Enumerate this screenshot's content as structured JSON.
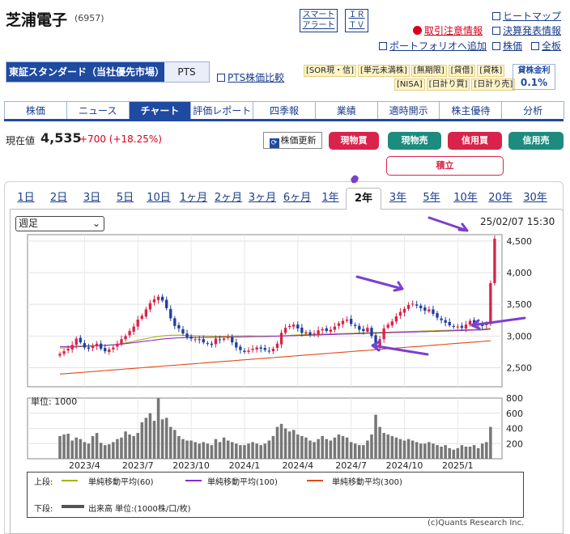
{
  "header": {
    "company": "芝浦電子",
    "code": "(6957)",
    "smart_alert": [
      "スマート",
      "アラート"
    ],
    "ir_tv": [
      "ＩＲ",
      "ＴＶ"
    ],
    "links": {
      "heatmap": "ヒートマップ",
      "restriction": "取引注意情報",
      "earnings": "決算発表情報",
      "portfolio": "ポートフォリオへ追加",
      "stock_price": "株価",
      "all_boards": "全板"
    }
  },
  "market": {
    "main": "東証スタンダード（当社優先市場）",
    "pts": "PTS",
    "pts_compare": "PTS株価比較",
    "tags_row1": [
      "[SOR現・信]",
      "[単元未満株]",
      "[無期限]",
      "[貸借]",
      "[貸株]"
    ],
    "tags_row2": [
      "[NISA]",
      "[日計り買]",
      "[日計り売]"
    ],
    "kashi_label": "貸株金利",
    "kashi_rate": "0.1%"
  },
  "tabs": [
    "株価",
    "ニュース",
    "チャート",
    "評価レポート",
    "四季報",
    "業績",
    "適時開示",
    "株主優待",
    "分析"
  ],
  "active_tab": "チャート",
  "price": {
    "label": "現在値",
    "value": "4,535",
    "change": "+700 (+18.25%)",
    "refresh": "株価更新",
    "buttons": {
      "spot_buy": "現物買",
      "spot_sell": "現物売",
      "margin_buy": "信用買",
      "margin_sell": "信用売",
      "accumulate": "積立"
    }
  },
  "periods": [
    "1日",
    "2日",
    "3日",
    "5日",
    "10日",
    "1ヶ月",
    "2ヶ月",
    "3ヶ月",
    "6ヶ月",
    "1年",
    "2年",
    "3年",
    "5年",
    "10年",
    "20年",
    "30年"
  ],
  "active_period": "2年",
  "chart_controls": {
    "interval": "週足",
    "datetime": "25/02/07 15:30",
    "volume_unit": "単位: 1000"
  },
  "chart_data": {
    "type": "candlestick",
    "x_labels": [
      "2023/4",
      "2023/7",
      "2023/10",
      "2024/1",
      "2024/4",
      "2024/7",
      "2024/10",
      "2025/1"
    ],
    "ylim": [
      2200,
      4600
    ],
    "y_ticks": [
      2500,
      3000,
      3500,
      4000,
      4500
    ],
    "volume_ylim": [
      0,
      800
    ],
    "volume_ticks": [
      200,
      400,
      600,
      800
    ],
    "closes": [
      2720,
      2760,
      2800,
      2860,
      2960,
      2900,
      2820,
      2800,
      2850,
      2880,
      2800,
      2760,
      2790,
      2820,
      2880,
      2950,
      3000,
      3080,
      3150,
      3260,
      3320,
      3420,
      3520,
      3580,
      3620,
      3560,
      3440,
      3280,
      3160,
      3120,
      3040,
      2980,
      2960,
      2950,
      2940,
      2900,
      2880,
      2860,
      2960,
      2940,
      2960,
      2990,
      2900,
      2820,
      2780,
      2750,
      2770,
      2800,
      2820,
      2800,
      2780,
      2760,
      2800,
      2880,
      3050,
      3130,
      3160,
      3180,
      3120,
      3050,
      3060,
      3020,
      3040,
      3090,
      3110,
      3080,
      3100,
      3150,
      3200,
      3240,
      3260,
      3190,
      3160,
      3100,
      3080,
      3130,
      3000,
      2830,
      2950,
      3120,
      3180,
      3230,
      3310,
      3380,
      3430,
      3490,
      3510,
      3480,
      3440,
      3400,
      3420,
      3350,
      3290,
      3250,
      3210,
      3170,
      3150,
      3150,
      3130,
      3180,
      3240,
      3200,
      3180,
      3160,
      3200,
      3835,
      4535
    ],
    "ma60": [
      2810,
      2815,
      2818,
      2822,
      2828,
      2832,
      2836,
      2838,
      2842,
      2846,
      2848,
      2852,
      2856,
      2862,
      2870,
      2880,
      2892,
      2904,
      2918,
      2932,
      2946,
      2960,
      2972,
      2984,
      2994,
      3002,
      3008,
      3012,
      3014,
      3014,
      3012,
      3010,
      3008,
      3006,
      3004,
      3002,
      3000,
      2999,
      2998,
      2998,
      2999,
      3000,
      3002,
      3003,
      3004,
      3004,
      3003,
      3002,
      3001,
      3000,
      3000,
      3000,
      3000,
      3001,
      3003,
      3006,
      3010,
      3014,
      3018,
      3020,
      3022,
      3024,
      3026,
      3028,
      3030,
      3032,
      3034,
      3036,
      3038,
      3040,
      3042,
      3044,
      3046,
      3048,
      3050,
      3052,
      3054,
      3056,
      3058,
      3060,
      3062,
      3064,
      3066,
      3068,
      3070,
      3072,
      3074,
      3076,
      3078,
      3080,
      3082,
      3084,
      3086,
      3088,
      3090,
      3092,
      3094,
      3096,
      3098,
      3100,
      3102,
      3104,
      3106,
      3108,
      3115,
      3125
    ],
    "ma100": [
      2830,
      2832,
      2834,
      2836,
      2838,
      2840,
      2842,
      2844,
      2846,
      2848,
      2850,
      2852,
      2856,
      2860,
      2866,
      2872,
      2880,
      2888,
      2896,
      2904,
      2912,
      2920,
      2928,
      2936,
      2944,
      2952,
      2958,
      2964,
      2968,
      2972,
      2974,
      2976,
      2977,
      2978,
      2979,
      2980,
      2980,
      2980,
      2981,
      2982,
      2983,
      2984,
      2985,
      2986,
      2987,
      2988,
      2989,
      2990,
      2991,
      2992,
      2993,
      2994,
      2996,
      2998,
      3000,
      3002,
      3004,
      3006,
      3008,
      3010,
      3012,
      3014,
      3016,
      3018,
      3020,
      3022,
      3024,
      3026,
      3028,
      3030,
      3032,
      3034,
      3036,
      3038,
      3040,
      3042,
      3044,
      3046,
      3048,
      3050,
      3052,
      3054,
      3056,
      3058,
      3060,
      3062,
      3064,
      3066,
      3068,
      3070,
      3072,
      3074,
      3076,
      3078,
      3080,
      3082,
      3084,
      3086,
      3088,
      3090,
      3092,
      3094,
      3096,
      3098,
      3102,
      3110
    ],
    "ma300": [
      2400,
      2405,
      2410,
      2415,
      2420,
      2425,
      2430,
      2435,
      2440,
      2445,
      2450,
      2455,
      2460,
      2465,
      2470,
      2475,
      2480,
      2485,
      2490,
      2495,
      2500,
      2505,
      2510,
      2515,
      2520,
      2525,
      2530,
      2535,
      2540,
      2545,
      2550,
      2555,
      2560,
      2565,
      2570,
      2575,
      2580,
      2585,
      2590,
      2595,
      2600,
      2605,
      2610,
      2615,
      2620,
      2625,
      2630,
      2635,
      2640,
      2645,
      2650,
      2655,
      2660,
      2665,
      2670,
      2675,
      2680,
      2685,
      2690,
      2695,
      2700,
      2705,
      2710,
      2715,
      2720,
      2725,
      2730,
      2735,
      2740,
      2745,
      2750,
      2755,
      2760,
      2765,
      2770,
      2775,
      2780,
      2785,
      2790,
      2795,
      2800,
      2805,
      2810,
      2815,
      2820,
      2825,
      2830,
      2835,
      2840,
      2845,
      2850,
      2855,
      2860,
      2865,
      2870,
      2875,
      2880,
      2885,
      2890,
      2895,
      2900,
      2905,
      2910,
      2915,
      2920,
      2925
    ],
    "volume": [
      300,
      320,
      330,
      240,
      280,
      260,
      220,
      200,
      300,
      340,
      210,
      180,
      190,
      220,
      260,
      280,
      360,
      320,
      300,
      340,
      480,
      540,
      600,
      500,
      800,
      520,
      540,
      420,
      380,
      300,
      260,
      240,
      240,
      220,
      200,
      220,
      200,
      180,
      260,
      220,
      280,
      240,
      220,
      200,
      180,
      180,
      200,
      220,
      200,
      180,
      200,
      240,
      300,
      420,
      460,
      400,
      360,
      380,
      320,
      300,
      280,
      240,
      220,
      260,
      300,
      260,
      240,
      280,
      320,
      300,
      280,
      220,
      200,
      180,
      180,
      240,
      320,
      580,
      420,
      340,
      320,
      300,
      280,
      260,
      240,
      260,
      240,
      220,
      200,
      200,
      220,
      200,
      180,
      160,
      180,
      140,
      120,
      140,
      180,
      160,
      160,
      180,
      140,
      200,
      220,
      420
    ]
  },
  "legend": {
    "upper_label": "上段:",
    "lower_label": "下段:",
    "ma60": "単純移動平均(60)",
    "ma100": "単純移動平均(100)",
    "ma300": "単純移動平均(300)",
    "volume": "出来高 単位:(1000株/口/枚)"
  },
  "colors": {
    "up": "#d9234a",
    "down": "#1f3fa0",
    "ma60": "#a8b400",
    "ma100": "#8a2ad0",
    "ma300": "#e24a1a",
    "volume": "#777777",
    "annotation": "#7b3fd0"
  },
  "copyright": "(c)Quants Research Inc."
}
